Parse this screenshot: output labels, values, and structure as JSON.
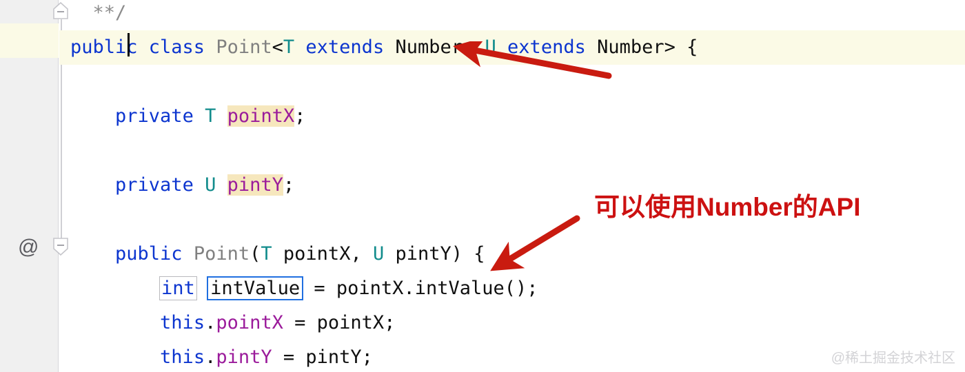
{
  "editor": {
    "background_color": "#ffffff",
    "gutter_color": "#f0f0f0",
    "current_line_color": "#fbfae6",
    "accent_color": "#cc1111",
    "keyword_color": "#0c35cf",
    "type_param_color": "#128c8c",
    "field_color": "#9b1b9b",
    "class_color": "#808080",
    "comment_color": "#8c8c8c",
    "field_highlight_color": "#f6e7bd"
  },
  "gutter": {
    "at_marker": "@",
    "fold_icon_top": "fold-collapse-icon",
    "fold_icon_bottom": "fold-collapse-icon"
  },
  "code": {
    "lines": [
      {
        "id": "comment-close",
        "tokens": [
          {
            "text": "  ",
            "kind": "plain"
          },
          {
            "text": "**/",
            "kind": "cmt"
          }
        ]
      },
      {
        "id": "class-decl",
        "current": true,
        "tokens": [
          {
            "text": "public class ",
            "kind": "kw"
          },
          {
            "text": "Point",
            "kind": "cls"
          },
          {
            "text": "<",
            "kind": "plain"
          },
          {
            "text": "T",
            "kind": "typ"
          },
          {
            "text": " ",
            "kind": "plain"
          },
          {
            "text": "extends",
            "kind": "kw"
          },
          {
            "text": " Number, ",
            "kind": "plain"
          },
          {
            "text": "U",
            "kind": "typ"
          },
          {
            "text": " ",
            "kind": "plain"
          },
          {
            "text": "extends",
            "kind": "kw"
          },
          {
            "text": " Number> {",
            "kind": "plain"
          }
        ]
      },
      {
        "id": "blank-1",
        "tokens": []
      },
      {
        "id": "field-pointx",
        "tokens": [
          {
            "text": "    ",
            "kind": "plain"
          },
          {
            "text": "private",
            "kind": "kw"
          },
          {
            "text": " ",
            "kind": "plain"
          },
          {
            "text": "T",
            "kind": "typ"
          },
          {
            "text": " ",
            "kind": "plain"
          },
          {
            "text": "pointX",
            "kind": "fld",
            "highlight": true
          },
          {
            "text": ";",
            "kind": "plain"
          }
        ]
      },
      {
        "id": "blank-2",
        "tokens": []
      },
      {
        "id": "field-pinty",
        "tokens": [
          {
            "text": "    ",
            "kind": "plain"
          },
          {
            "text": "private",
            "kind": "kw"
          },
          {
            "text": " ",
            "kind": "plain"
          },
          {
            "text": "U",
            "kind": "typ"
          },
          {
            "text": " ",
            "kind": "plain"
          },
          {
            "text": "pintY",
            "kind": "fld",
            "highlight": true
          },
          {
            "text": ";",
            "kind": "plain"
          }
        ]
      },
      {
        "id": "blank-3",
        "tokens": []
      },
      {
        "id": "constructor-decl",
        "tokens": [
          {
            "text": "    ",
            "kind": "plain"
          },
          {
            "text": "public",
            "kind": "kw"
          },
          {
            "text": " ",
            "kind": "plain"
          },
          {
            "text": "Point",
            "kind": "cls"
          },
          {
            "text": "(",
            "kind": "plain"
          },
          {
            "text": "T",
            "kind": "typ"
          },
          {
            "text": " pointX, ",
            "kind": "plain"
          },
          {
            "text": "U",
            "kind": "typ"
          },
          {
            "text": " pintY) {",
            "kind": "plain"
          }
        ]
      },
      {
        "id": "int-value-decl",
        "tokens": [
          {
            "text": "        ",
            "kind": "plain"
          },
          {
            "text": "int",
            "kind": "kw",
            "box": "gray"
          },
          {
            "text": " ",
            "kind": "plain"
          },
          {
            "text": "intValue",
            "kind": "plain",
            "box": "blue"
          },
          {
            "text": " = pointX.intValue();",
            "kind": "plain"
          }
        ]
      },
      {
        "id": "assign-pointx",
        "tokens": [
          {
            "text": "        ",
            "kind": "plain"
          },
          {
            "text": "this",
            "kind": "kw"
          },
          {
            "text": ".",
            "kind": "plain"
          },
          {
            "text": "pointX",
            "kind": "fld"
          },
          {
            "text": " = pointX;",
            "kind": "plain"
          }
        ]
      },
      {
        "id": "assign-pinty",
        "tokens": [
          {
            "text": "        ",
            "kind": "plain"
          },
          {
            "text": "this",
            "kind": "kw"
          },
          {
            "text": ".",
            "kind": "plain"
          },
          {
            "text": "pintY",
            "kind": "fld"
          },
          {
            "text": " = pintY;",
            "kind": "plain"
          }
        ]
      }
    ]
  },
  "annotations": {
    "note_text": "可以使用Number的API",
    "arrow_to_number": "arrow-pointing-to-number",
    "arrow_to_intvalue": "arrow-pointing-to-intvalue"
  },
  "watermark": {
    "text": "@稀土掘金技术社区"
  }
}
